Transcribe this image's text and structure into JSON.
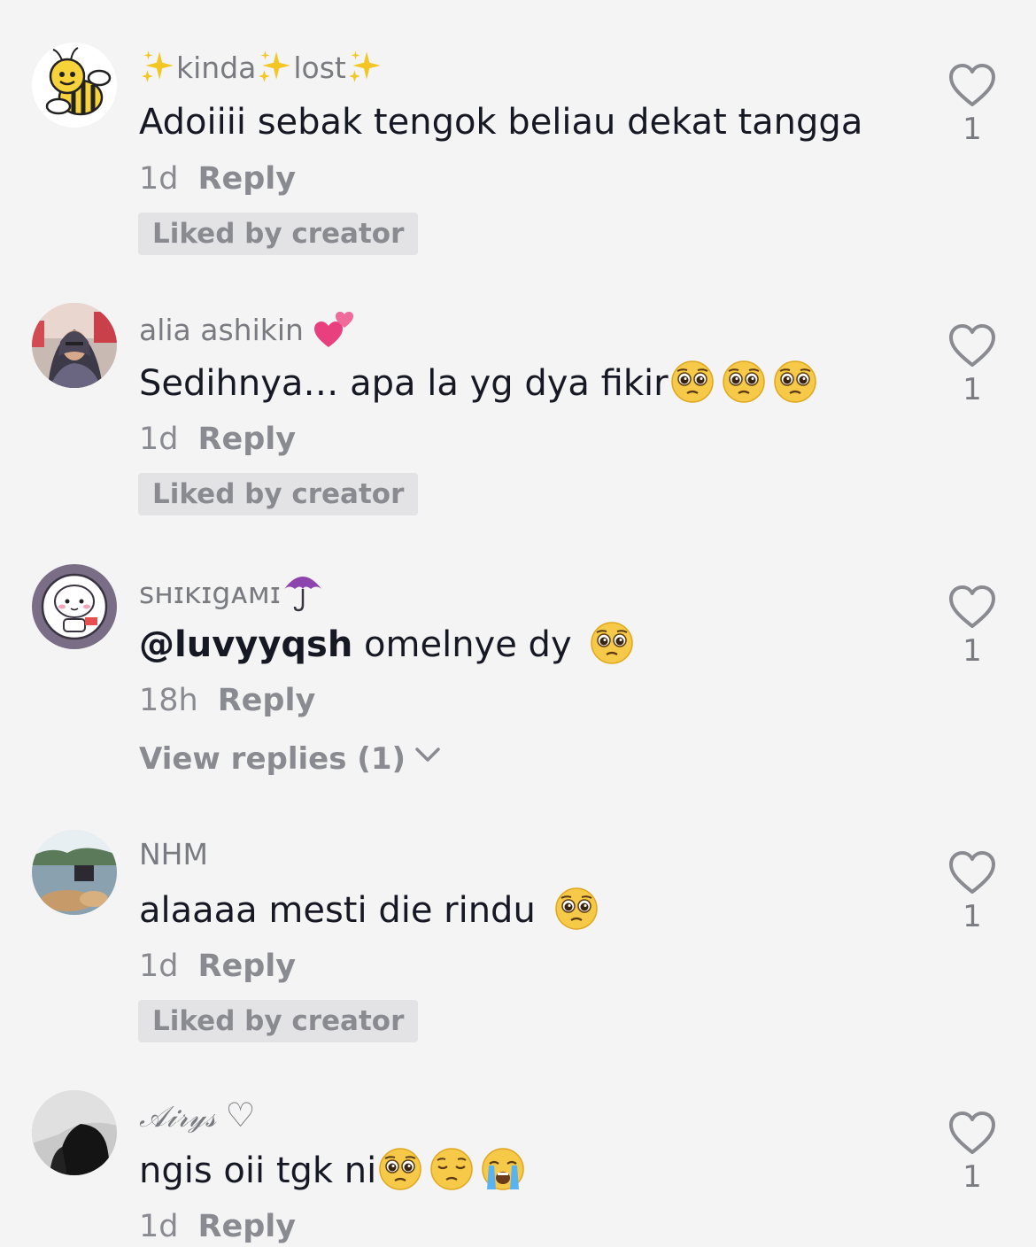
{
  "comments": [
    {
      "username": "kinda",
      "username_extra": "lost",
      "text": "Adoiiii sebak tengok beliau dekat tangga",
      "time": "1d",
      "reply": "Reply",
      "badge": "Liked by creator",
      "likes": "1"
    },
    {
      "username": "alia ashikin ",
      "text": "Sedihnya… apa la yg dya fikir",
      "time": "1d",
      "reply": "Reply",
      "badge": "Liked by creator",
      "likes": "1"
    },
    {
      "username": "sʜɪᴋɪgᴀᴍɪ",
      "mention": "@luvyyqsh",
      "text": " omelnye dy ",
      "time": "18h",
      "reply": "Reply",
      "view_replies": "View replies (1)",
      "likes": "1"
    },
    {
      "username": "NHM",
      "text": "alaaaa mesti die rindu ",
      "time": "1d",
      "reply": "Reply",
      "badge": "Liked by creator",
      "likes": "1"
    },
    {
      "username": "𝒜𝒾𝓇𝓎𝓈",
      "username_extra": "♡",
      "text": "ngis oii tgk ni",
      "time": "1d",
      "reply": "Reply",
      "likes": "1"
    }
  ],
  "colors": {
    "text": "#161823",
    "secondary": "#8a8b91",
    "badge_bg": "#e3e3e5",
    "background": "#f4f4f4"
  },
  "icons": [
    "heart-outline-icon",
    "chevron-down-icon",
    "pleading-face-emoji",
    "pensive-face-emoji",
    "loudly-crying-face-emoji",
    "sparkles-emoji",
    "two-hearts-emoji",
    "umbrella-emoji"
  ]
}
